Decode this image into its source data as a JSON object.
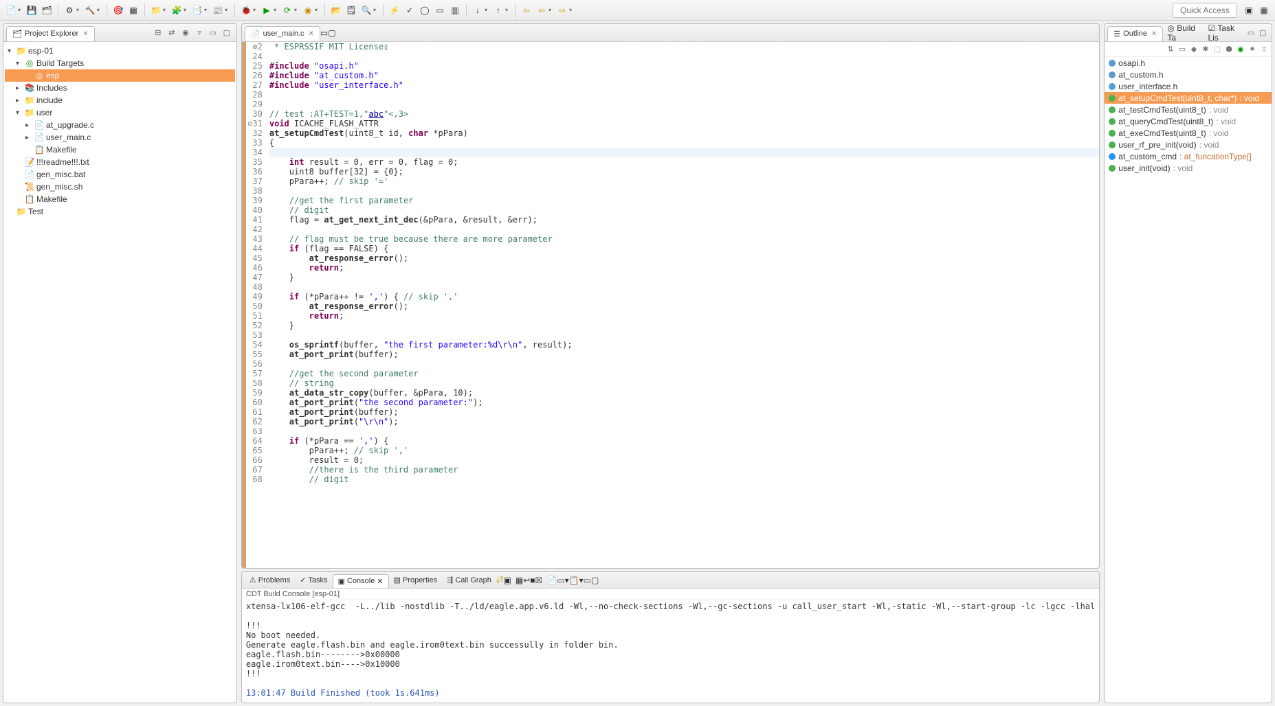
{
  "toolbar": {
    "quick_access": "Quick Access"
  },
  "project_explorer": {
    "title": "Project Explorer",
    "tree": {
      "root": "esp-01",
      "build_targets": "Build Targets",
      "esp": "esp",
      "includes": "Includes",
      "include": "include",
      "user": "user",
      "at_upgrade": "at_upgrade.c",
      "user_main": "user_main.c",
      "makefile1": "Makefile",
      "readme": "!!!readme!!!.txt",
      "gen_misc_bat": "gen_misc.bat",
      "gen_misc_sh": "gen_misc.sh",
      "makefile2": "Makefile",
      "test": "Test"
    }
  },
  "editor": {
    "tab": "user_main.c",
    "lines": [
      {
        "n": "2",
        "mark": "⊕",
        "html": "<span class='cmt'> * ESPRSSIF MIT License▯</span>"
      },
      {
        "n": "24",
        "html": ""
      },
      {
        "n": "25",
        "html": "<span class='pp'>#include</span> <span class='str'>\"osapi.h\"</span>"
      },
      {
        "n": "26",
        "html": "<span class='pp'>#include</span> <span class='str'>\"at_custom.h\"</span>"
      },
      {
        "n": "27",
        "html": "<span class='pp'>#include</span> <span class='str'>\"user_interface.h\"</span>"
      },
      {
        "n": "28",
        "html": ""
      },
      {
        "n": "29",
        "html": ""
      },
      {
        "n": "30",
        "html": "<span class='cmt'>// test :AT+TEST=1,\"<span class='link'>abc</span>\"&lt;,3&gt;</span>"
      },
      {
        "n": "31",
        "mark": "⊖",
        "html": "<span class='kw'>void</span> ICACHE_FLASH_ATTR"
      },
      {
        "n": "32",
        "html": "<span class='fn'>at_setupCmdTest</span>(uint8_t id, <span class='kw'>char</span> *pPara)"
      },
      {
        "n": "33",
        "html": "{"
      },
      {
        "n": "34",
        "hl": true,
        "html": ""
      },
      {
        "n": "35",
        "html": "    <span class='kw'>int</span> result = 0, err = 0, flag = 0;"
      },
      {
        "n": "36",
        "html": "    uint8 buffer[32] = {0};"
      },
      {
        "n": "37",
        "html": "    pPara++; <span class='cmt'>// skip '='</span>"
      },
      {
        "n": "38",
        "html": ""
      },
      {
        "n": "39",
        "html": "    <span class='cmt'>//get the first parameter</span>"
      },
      {
        "n": "40",
        "html": "    <span class='cmt'>// digit</span>"
      },
      {
        "n": "41",
        "html": "    flag = <span class='fn'>at_get_next_int_dec</span>(&amp;pPara, &amp;result, &amp;err);"
      },
      {
        "n": "42",
        "html": ""
      },
      {
        "n": "43",
        "html": "    <span class='cmt'>// flag must be true because there are more parameter</span>"
      },
      {
        "n": "44",
        "html": "    <span class='kw'>if</span> (flag == FALSE) {"
      },
      {
        "n": "45",
        "html": "        <span class='fn'>at_response_error</span>();"
      },
      {
        "n": "46",
        "html": "        <span class='kw'>return</span>;"
      },
      {
        "n": "47",
        "html": "    }"
      },
      {
        "n": "48",
        "html": ""
      },
      {
        "n": "49",
        "html": "    <span class='kw'>if</span> (*pPara++ != <span class='str'>','</span>) { <span class='cmt'>// skip ','</span>"
      },
      {
        "n": "50",
        "html": "        <span class='fn'>at_response_error</span>();"
      },
      {
        "n": "51",
        "html": "        <span class='kw'>return</span>;"
      },
      {
        "n": "52",
        "html": "    }"
      },
      {
        "n": "53",
        "html": ""
      },
      {
        "n": "54",
        "html": "    <span class='fn'>os_sprintf</span>(buffer, <span class='str'>\"the first parameter:%d\\r\\n\"</span>, result);"
      },
      {
        "n": "55",
        "html": "    <span class='fn'>at_port_print</span>(buffer);"
      },
      {
        "n": "56",
        "html": ""
      },
      {
        "n": "57",
        "html": "    <span class='cmt'>//get the second parameter</span>"
      },
      {
        "n": "58",
        "html": "    <span class='cmt'>// string</span>"
      },
      {
        "n": "59",
        "html": "    <span class='fn'>at_data_str_copy</span>(buffer, &amp;pPara, 10);"
      },
      {
        "n": "60",
        "html": "    <span class='fn'>at_port_print</span>(<span class='str'>\"the second parameter:\"</span>);"
      },
      {
        "n": "61",
        "html": "    <span class='fn'>at_port_print</span>(buffer);"
      },
      {
        "n": "62",
        "html": "    <span class='fn'>at_port_print</span>(<span class='str'>\"\\r\\n\"</span>);"
      },
      {
        "n": "63",
        "html": ""
      },
      {
        "n": "64",
        "html": "    <span class='kw'>if</span> (*pPara == <span class='str'>','</span>) {"
      },
      {
        "n": "65",
        "html": "        pPara++; <span class='cmt'>// skip ','</span>"
      },
      {
        "n": "66",
        "html": "        result = 0;"
      },
      {
        "n": "67",
        "html": "        <span class='cmt'>//there is the third parameter</span>"
      },
      {
        "n": "68",
        "html": "        <span class='cmt'>// digit</span>"
      }
    ]
  },
  "bottom": {
    "tabs": {
      "problems": "Problems",
      "tasks": "Tasks",
      "console": "Console",
      "properties": "Properties",
      "callgraph": "Call Graph"
    },
    "console_sub": "CDT Build Console [esp-01]",
    "console_lines": [
      "xtensa-lx106-elf-gcc  -L../lib -nostdlib -T../ld/eagle.app.v6.ld -Wl,--no-check-sections -Wl,--gc-sections -u call_user_start -Wl,-static -Wl,--start-group -lc -lgcc -lhal",
      "",
      "!!!",
      "No boot needed.",
      "Generate eagle.flash.bin and eagle.irom0text.bin successully in folder bin.",
      "eagle.flash.bin-------->0x00000",
      "eagle.irom0text.bin---->0x10000",
      "!!!",
      "",
      {
        "cls": "ok",
        "t": "13:01:47 Build Finished (took 1s.641ms)"
      }
    ]
  },
  "outline": {
    "title": "Outline",
    "tabs": {
      "build": "Build Ta",
      "tasklist": "Task Lis"
    },
    "items": [
      {
        "icon": "inc",
        "name": "osapi.h"
      },
      {
        "icon": "inc",
        "name": "at_custom.h"
      },
      {
        "icon": "inc",
        "name": "user_interface.h"
      },
      {
        "icon": "fn",
        "name": "at_setupCmdTest(uint8_t, char*)",
        "ret": ": void",
        "sel": true
      },
      {
        "icon": "fn",
        "name": "at_testCmdTest(uint8_t)",
        "ret": ": void"
      },
      {
        "icon": "fn",
        "name": "at_queryCmdTest(uint8_t)",
        "ret": ": void"
      },
      {
        "icon": "fn",
        "name": "at_exeCmdTest(uint8_t)",
        "ret": ": void"
      },
      {
        "icon": "fn",
        "name": "user_rf_pre_init(void)",
        "ret": ": void"
      },
      {
        "icon": "var",
        "name": "at_custom_cmd",
        "ret2": ": at_funcationType[]"
      },
      {
        "icon": "fn",
        "name": "user_init(void)",
        "ret": ": void"
      }
    ]
  }
}
